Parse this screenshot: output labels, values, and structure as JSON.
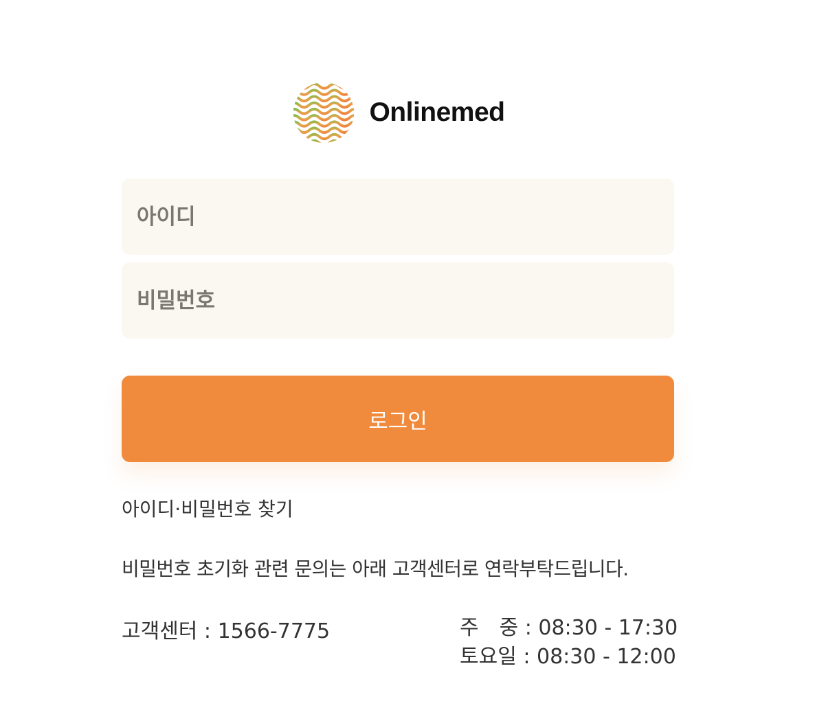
{
  "brand": {
    "name": "Onlinemed",
    "colors": {
      "accent": "#f08a3c",
      "field_bg": "#fbf8f1",
      "logo_green": "#7bbf4a"
    }
  },
  "login_form": {
    "id_placeholder": "아이디",
    "password_placeholder": "비밀번호",
    "login_label": "로그인"
  },
  "links": {
    "find_account": "아이디·비밀번호 찾기"
  },
  "notice": "비밀번호 초기화 관련 문의는 아래 고객센터로 연락부탁드립니다.",
  "customer_center": {
    "phone": "고객센터 : 1566-7775",
    "weekday_hours": "주　중 : 08:30 - 17:30",
    "saturday_hours": "토요일 : 08:30 - 12:00"
  },
  "icons": {
    "logo": "wavy-globe-logo-icon"
  }
}
